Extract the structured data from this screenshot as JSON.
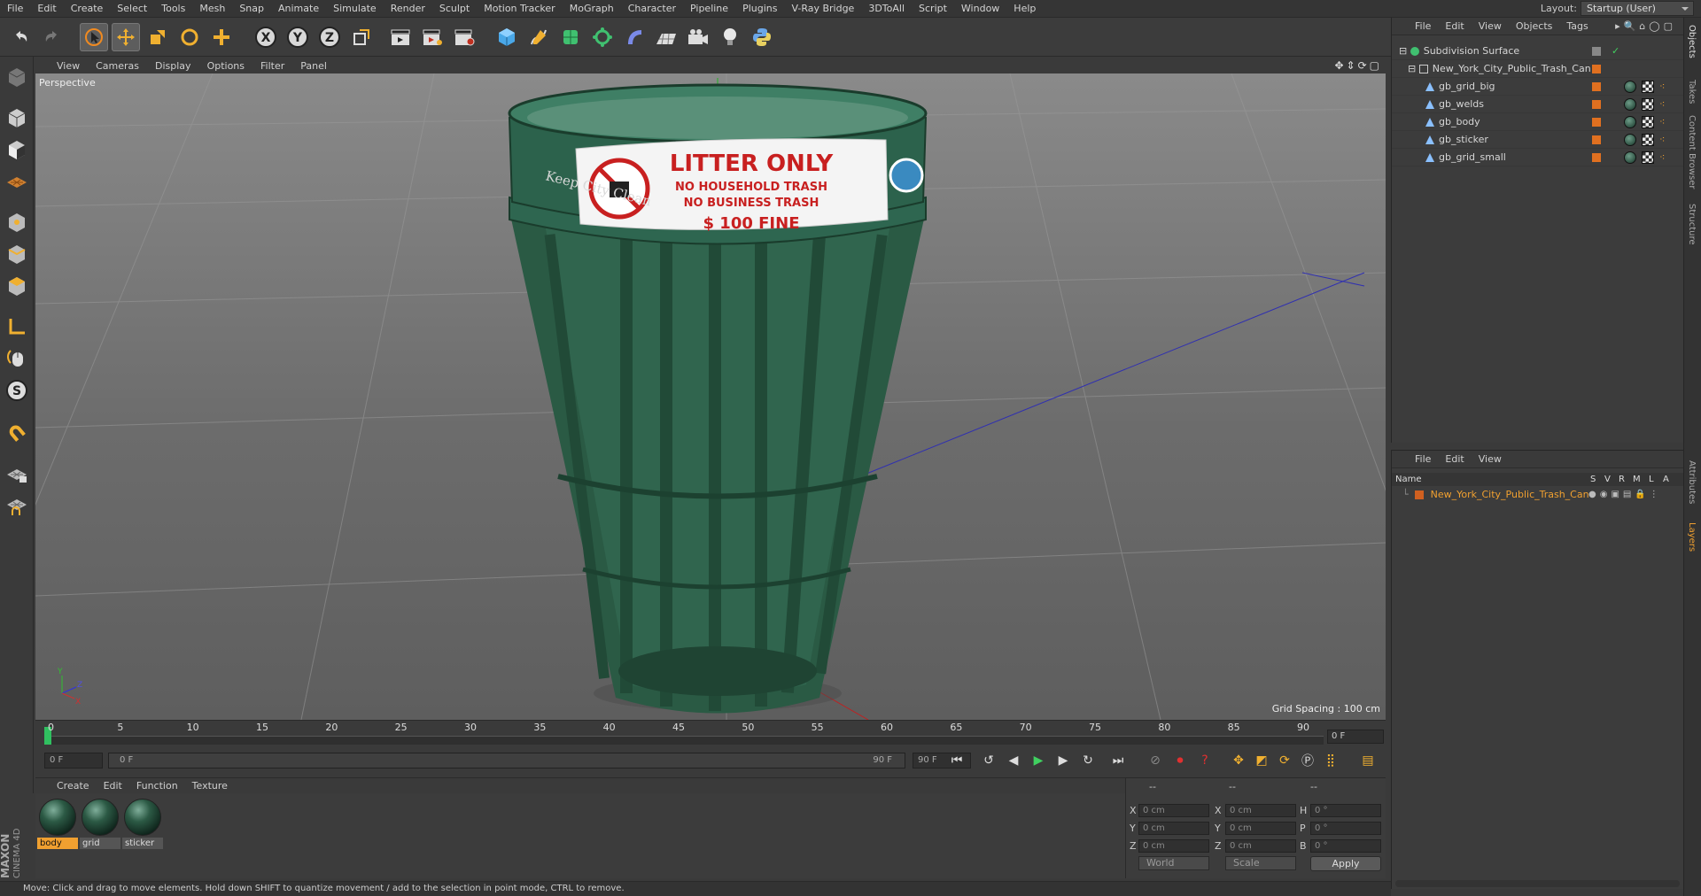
{
  "menubar": [
    "File",
    "Edit",
    "Create",
    "Select",
    "Tools",
    "Mesh",
    "Snap",
    "Animate",
    "Simulate",
    "Render",
    "Sculpt",
    "Motion Tracker",
    "MoGraph",
    "Character",
    "Pipeline",
    "Plugins",
    "V-Ray Bridge",
    "3DToAll",
    "Script",
    "Window",
    "Help"
  ],
  "layout": {
    "label": "Layout:",
    "value": "Startup (User)"
  },
  "viewport": {
    "menu": [
      "View",
      "Cameras",
      "Display",
      "Options",
      "Filter",
      "Panel"
    ],
    "label": "Perspective",
    "grid_spacing": "Grid Spacing : 100 cm",
    "axis_y": "Y",
    "axis_z": "Z",
    "axis_x": "X"
  },
  "sign": {
    "line1": "LITTER ONLY",
    "line2": "NO HOUSEHOLD TRASH",
    "line3": "NO BUSINESS TRASH",
    "line4": "$ 100 FINE",
    "side_text": "Keep City Clean"
  },
  "timeline": {
    "ticks": [
      "0",
      "5",
      "10",
      "15",
      "20",
      "25",
      "30",
      "35",
      "40",
      "45",
      "50",
      "55",
      "60",
      "65",
      "70",
      "75",
      "80",
      "85",
      "90"
    ],
    "current_frame": "0 F"
  },
  "transport": {
    "start": "0 F",
    "range_start": "0 F",
    "range_end": "90 F",
    "end": "90 F"
  },
  "materials": {
    "menu": [
      "Create",
      "Edit",
      "Function",
      "Texture"
    ],
    "items": [
      {
        "name": "body",
        "selected": true
      },
      {
        "name": "grid",
        "selected": false
      },
      {
        "name": "sticker",
        "selected": false
      }
    ]
  },
  "coords": {
    "headers": [
      "--",
      "--",
      "--"
    ],
    "rows": [
      {
        "l1": "X",
        "v1": "0 cm",
        "l2": "X",
        "v2": "0 cm",
        "l3": "H",
        "v3": "0 °"
      },
      {
        "l1": "Y",
        "v1": "0 cm",
        "l2": "Y",
        "v2": "0 cm",
        "l3": "P",
        "v3": "0 °"
      },
      {
        "l1": "Z",
        "v1": "0 cm",
        "l2": "Z",
        "v2": "0 cm",
        "l3": "B",
        "v3": "0 °"
      }
    ],
    "world": "World",
    "scale": "Scale",
    "apply": "Apply"
  },
  "status": "Move: Click and drag to move elements. Hold down SHIFT to quantize movement / add to the selection in point mode, CTRL to remove.",
  "object_manager": {
    "menu": [
      "File",
      "Edit",
      "View",
      "Objects",
      "Tags"
    ],
    "objects": [
      {
        "name": "Subdivision Surface",
        "indent": 0,
        "kind": "subdiv"
      },
      {
        "name": "New_York_City_Public_Trash_Can",
        "indent": 1,
        "kind": "null"
      },
      {
        "name": "gb_grid_big",
        "indent": 2,
        "kind": "mesh"
      },
      {
        "name": "gb_welds",
        "indent": 2,
        "kind": "mesh"
      },
      {
        "name": "gb_body",
        "indent": 2,
        "kind": "mesh"
      },
      {
        "name": "gb_sticker",
        "indent": 2,
        "kind": "mesh"
      },
      {
        "name": "gb_grid_small",
        "indent": 2,
        "kind": "mesh"
      }
    ]
  },
  "layer_manager": {
    "menu": [
      "File",
      "Edit",
      "View"
    ],
    "columns": {
      "name": "Name",
      "s": "S",
      "v": "V",
      "r": "R",
      "m": "M",
      "l": "L",
      "a": "A"
    },
    "layers": [
      {
        "name": "New_York_City_Public_Trash_Can",
        "color": "#d06020"
      }
    ]
  },
  "right_tabs": [
    "Objects",
    "Takes",
    "Content Browser",
    "Structure",
    "Attributes",
    "Layers"
  ],
  "brand": {
    "maxon": "MAXON",
    "product": "CINEMA 4D"
  },
  "colors": {
    "accent": "#f0a030",
    "selection": "#e07020",
    "can_green": "#2a5a44"
  }
}
